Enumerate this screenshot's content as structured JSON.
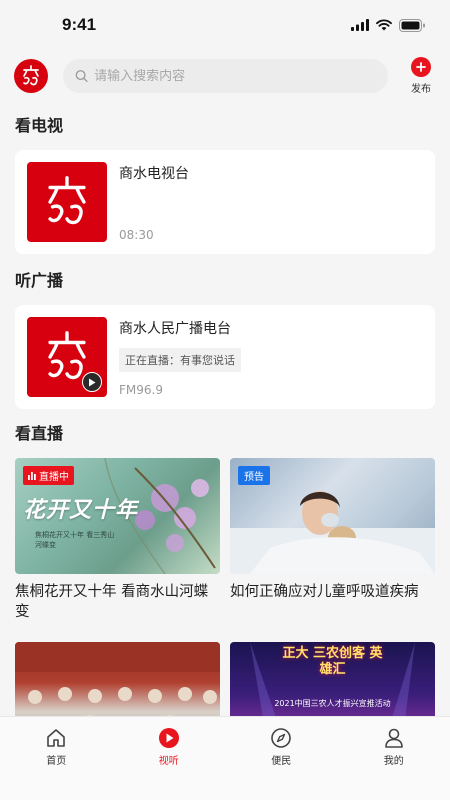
{
  "status_bar": {
    "time": "9:41"
  },
  "header": {
    "search_placeholder": "请输入搜索内容",
    "publish_label": "发布"
  },
  "sections": {
    "tv_title": "看电视",
    "radio_title": "听广播",
    "live_title": "看直播"
  },
  "tv_card": {
    "title": "商水电视台",
    "time": "08:30"
  },
  "radio_card": {
    "title": "商水人民广播电台",
    "now_playing": "正在直播：有事您说话",
    "frequency": "FM96.9"
  },
  "live_items": [
    {
      "badge": "直播中",
      "title": "焦桐花开又十年 看商水山河蝶变",
      "overlay_big": "花开又十年",
      "overlay_small": "焦桐花开又十年 看三秀山河蝶变"
    },
    {
      "badge": "预告",
      "title": "如何正确应对儿童呼吸道疾病"
    },
    {
      "badge": "",
      "title": ""
    },
    {
      "badge": "",
      "title": "",
      "overlay_big": "正大 三农创客 英雄汇",
      "overlay_small": "2021中国三农人才振兴宣推活动"
    }
  ],
  "tabs": [
    {
      "label": "首页",
      "icon": "home-icon",
      "active": false
    },
    {
      "label": "视听",
      "icon": "play-icon",
      "active": true
    },
    {
      "label": "便民",
      "icon": "compass-icon",
      "active": false
    },
    {
      "label": "我的",
      "icon": "user-icon",
      "active": false
    }
  ],
  "colors": {
    "brand_red": "#d7000f",
    "accent_red": "#e8151f",
    "preview_blue": "#1a73e8"
  }
}
